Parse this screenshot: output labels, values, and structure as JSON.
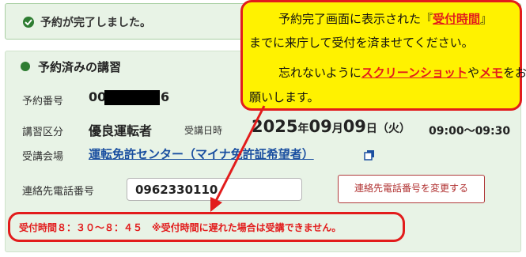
{
  "banner": {
    "message": "予約が完了しました。",
    "icon": "check-circle-icon"
  },
  "reservation": {
    "section_title": "予約済みの講習",
    "number_label": "予約番号",
    "number_prefix": "00",
    "number_suffix": "6",
    "category_label": "講習区分",
    "category_value": "優良運転者",
    "date_label": "受講日時",
    "date_year": "2025",
    "date_year_unit": "年",
    "date_month": "09",
    "date_month_unit": "月",
    "date_day": "09",
    "date_day_unit": "日",
    "date_weekday": "（火）",
    "time_range": "09:00〜09:30",
    "venue_label": "受講会場",
    "venue_value": "運転免許センター（マイナ免許証希望者）",
    "phone_label": "連絡先電話番号",
    "phone_value": "0962330110",
    "change_phone_button": "連絡先電話番号を変更する",
    "notice": "受付時間８：３０〜８：４５　※受付時間に遅れた場合は受講できません。"
  },
  "callout": {
    "line1_pre": "予約完了画面に表示された『",
    "line1_hl": "受付時間",
    "line1_post": "』",
    "line2": "までに来庁して受付を済ませてください。",
    "line3_pre": "忘れないように",
    "line3_hl1": "スクリーンショット",
    "line3_mid": "や",
    "line3_hl2": "メモ",
    "line3_post": "をお",
    "line4": "願いします。"
  },
  "colors": {
    "accent_green": "#2e7d32",
    "alert_red": "#e21c1c",
    "highlight_yellow": "#fff200",
    "link_blue": "#1a4fa0"
  }
}
